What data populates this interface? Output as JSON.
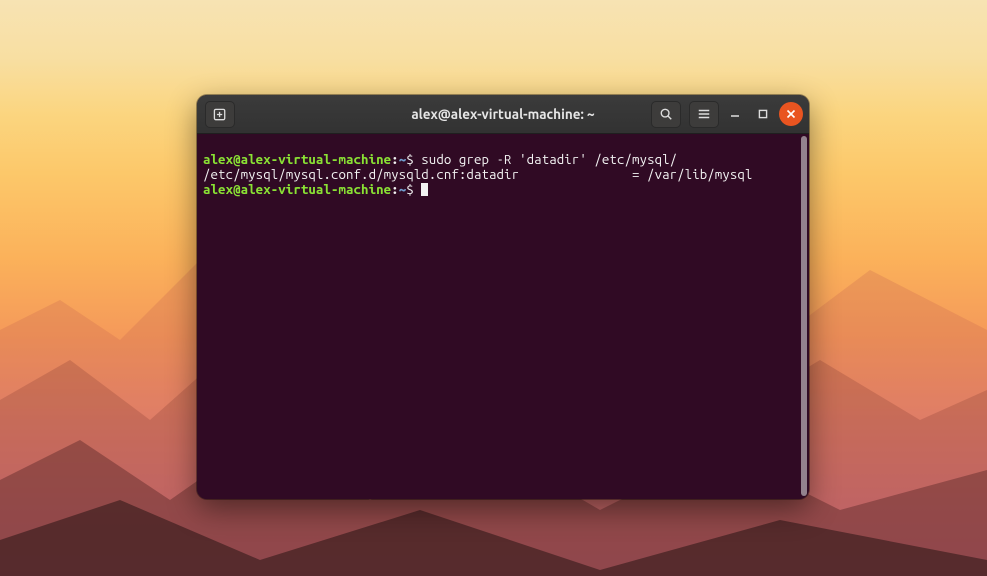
{
  "titlebar": {
    "title": "alex@alex-virtual-machine: ~",
    "icons": {
      "newtab": "new-tab-icon",
      "search": "search-icon",
      "menu": "hamburger-icon",
      "minimize": "minimize-icon",
      "maximize": "maximize-icon",
      "close": "close-icon"
    }
  },
  "terminal": {
    "prompt": {
      "user_host": "alex@alex-virtual-machine",
      "separator": ":",
      "path": "~",
      "symbol": "$"
    },
    "line1": {
      "command": "sudo grep -R 'datadir' /etc/mysql/"
    },
    "line2": {
      "output": "/etc/mysql/mysql.conf.d/mysqld.cnf:datadir               = /var/lib/mysql"
    }
  },
  "colors": {
    "window_bg": "#300a24",
    "titlebar_bg": "#323232",
    "accent_close": "#e95420",
    "prompt_user": "#8ae234",
    "prompt_path": "#729fcf",
    "text": "#f2f2f2"
  }
}
